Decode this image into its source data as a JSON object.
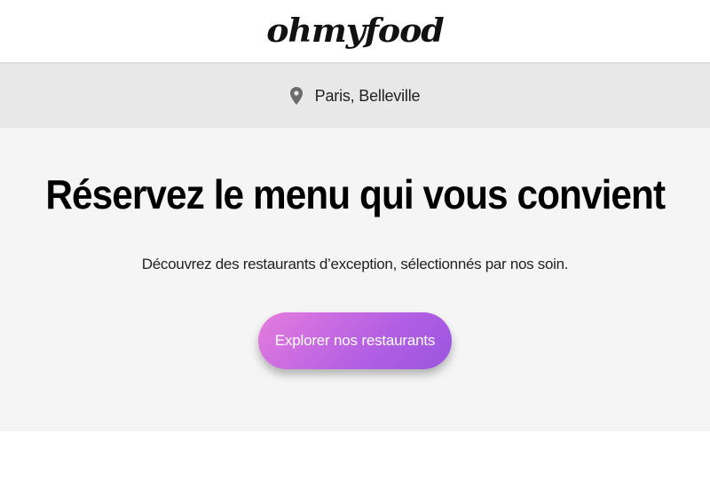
{
  "header": {
    "logo_text": "ohmyfood"
  },
  "location": {
    "icon": "location-pin-icon",
    "text": "Paris, Belleville"
  },
  "hero": {
    "title": "Réservez le menu qui vous convient",
    "subtitle": "Découvrez des restaurants d’exception, sélectionnés par nos soin.",
    "cta_label": "Explorer nos restaurants"
  },
  "colors": {
    "header_bg": "#ffffff",
    "location_bar_bg": "#e8e8e8",
    "hero_bg": "#f5f5f5",
    "button_gradient_start": "#e57cdd",
    "button_gradient_end": "#9a55e0",
    "pin_color": "#6b6b6b"
  }
}
